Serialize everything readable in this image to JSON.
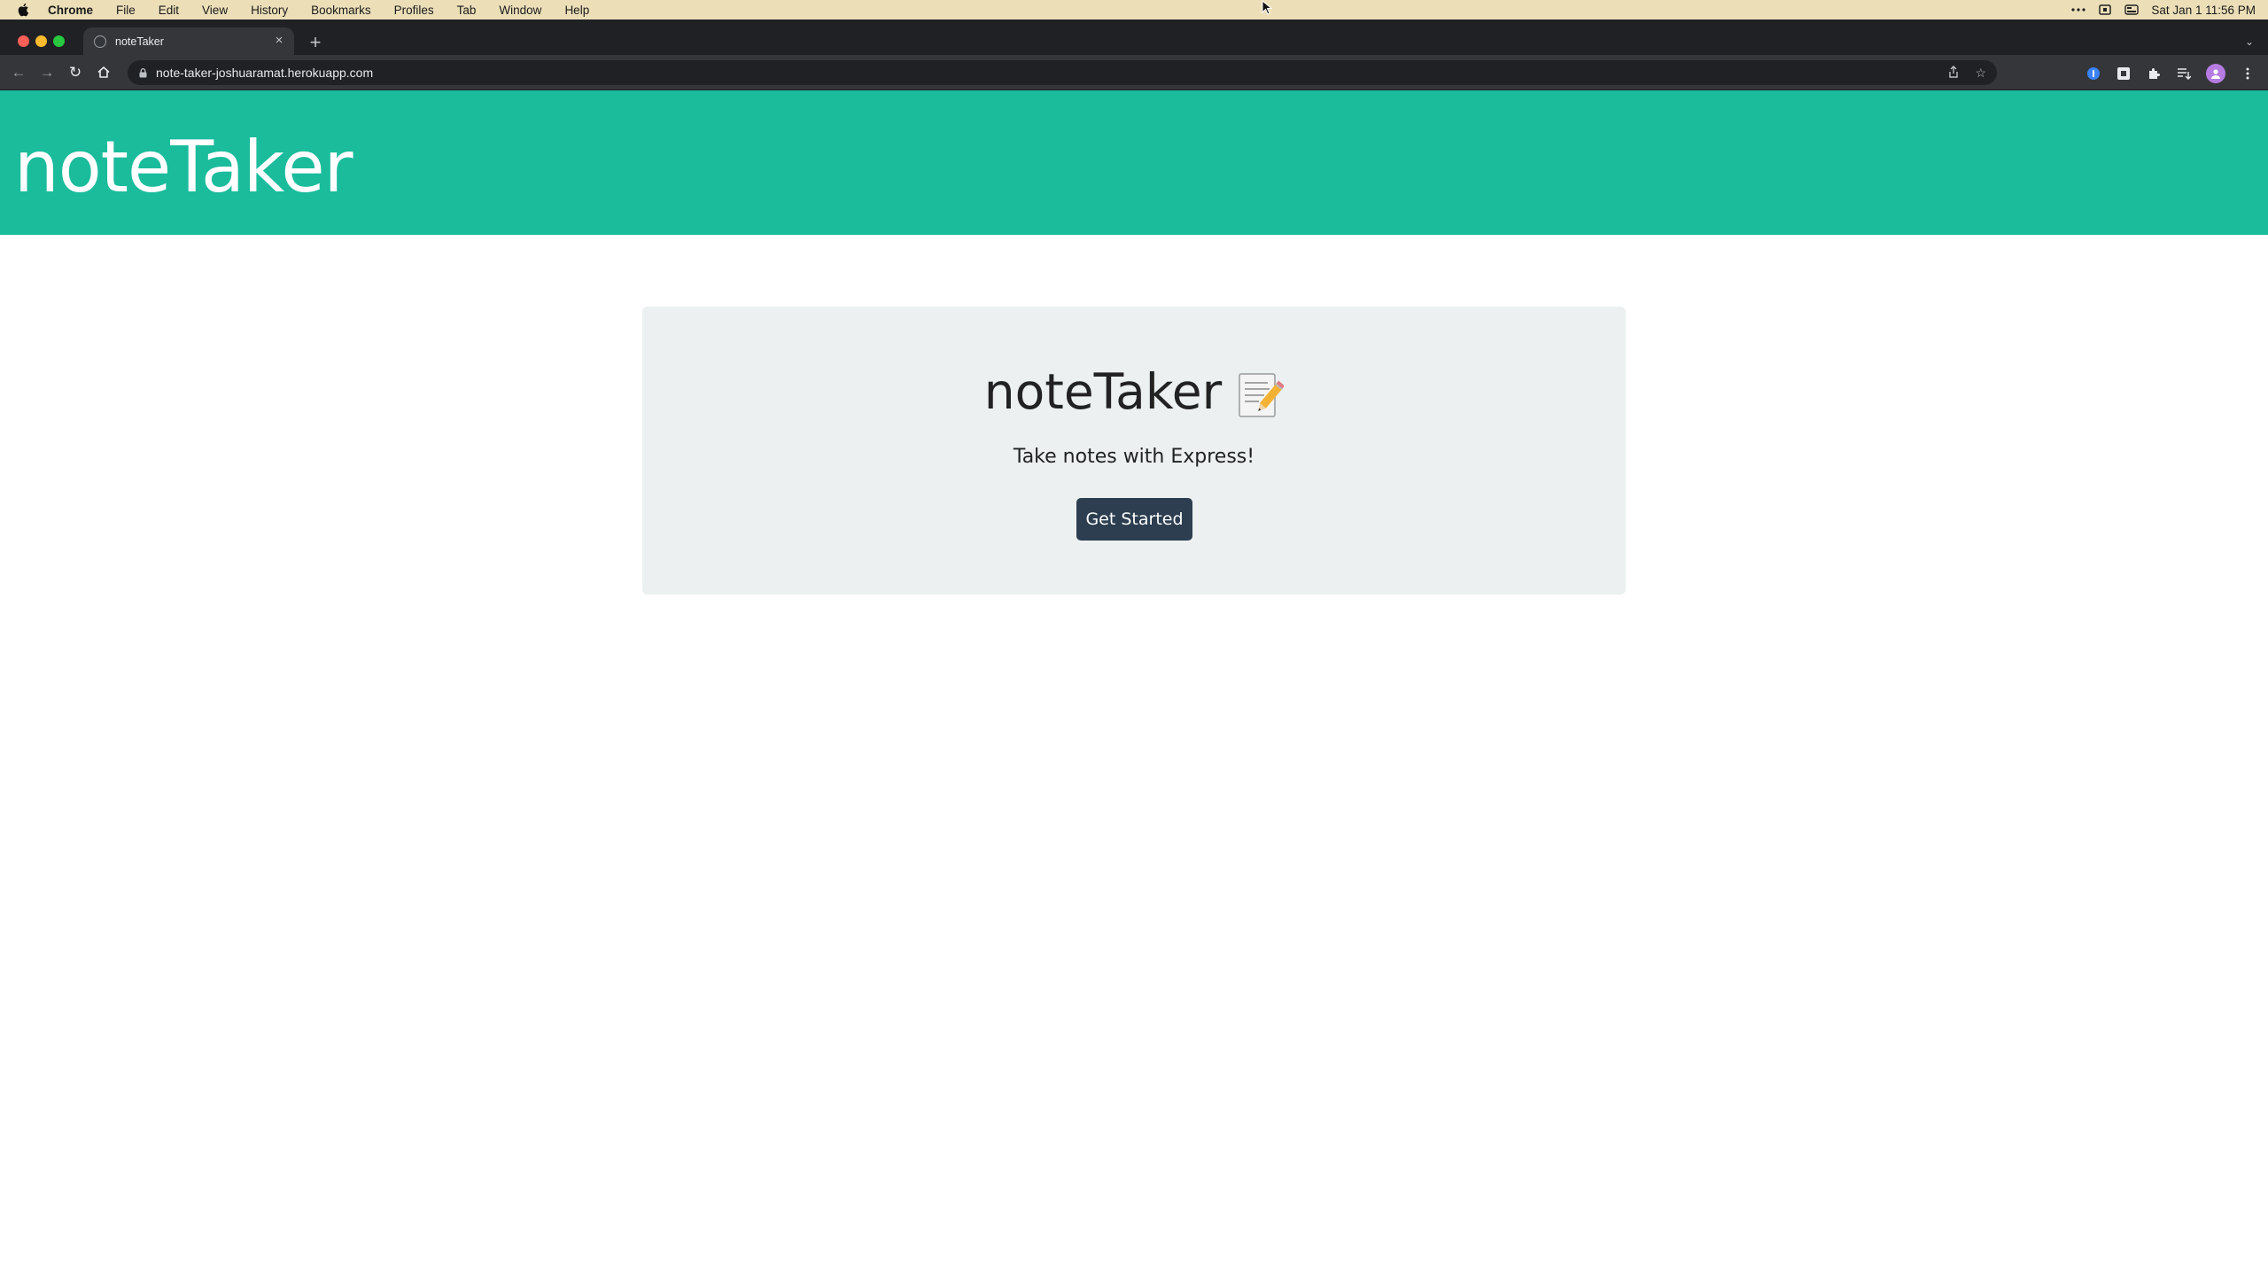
{
  "menubar": {
    "app_name": "Chrome",
    "items": [
      "File",
      "Edit",
      "View",
      "History",
      "Bookmarks",
      "Profiles",
      "Tab",
      "Window",
      "Help"
    ],
    "clock": "Sat Jan 1  11:56 PM"
  },
  "browser": {
    "tab_title": "noteTaker",
    "url": "note-taker-joshuaramat.herokuapp.com"
  },
  "page": {
    "brand": "noteTaker",
    "hero": {
      "title": "noteTaker",
      "emoji": "memo-pencil-icon",
      "subtitle": "Take notes with Express!",
      "cta_label": "Get Started"
    }
  },
  "colors": {
    "header_bg": "#1abc9c",
    "jumbotron_bg": "#ecf0f1",
    "button_bg": "#2c3e50"
  }
}
